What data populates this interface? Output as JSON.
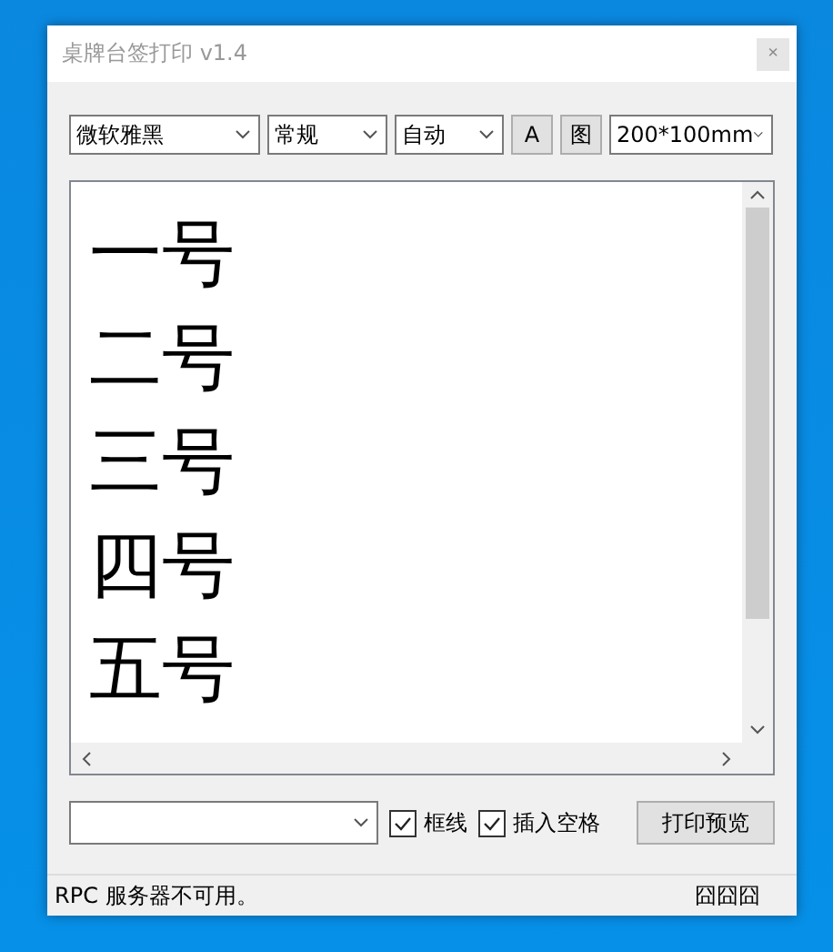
{
  "window": {
    "title": "桌牌台签打印 v1.4",
    "close": "×"
  },
  "toolbar": {
    "font": "微软雅黑",
    "style": "常规",
    "size": "自动",
    "buttons": [
      "A",
      "图"
    ],
    "paper": "200*100mm"
  },
  "editor": {
    "lines": [
      "一号",
      "二号",
      "三号",
      "四号",
      "五号"
    ]
  },
  "bottom": {
    "checkboxes": [
      {
        "label": "框线",
        "checked": true
      },
      {
        "label": "插入空格",
        "checked": true
      }
    ],
    "button": "打印预览"
  },
  "status_bar": {
    "message": "RPC 服务器不可用。",
    "right": "囧囧囧"
  }
}
